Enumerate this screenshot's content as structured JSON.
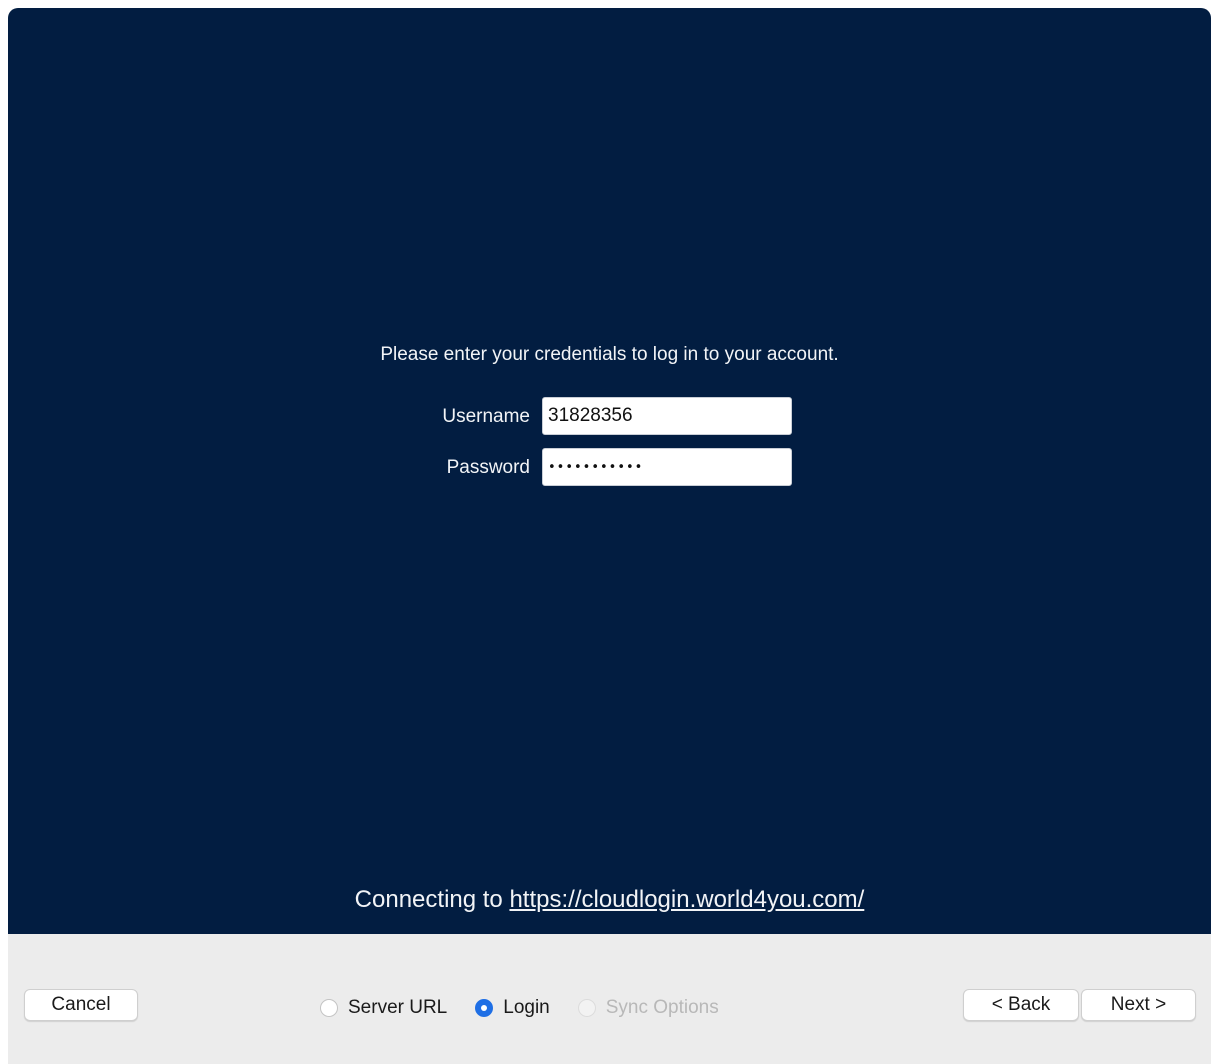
{
  "content": {
    "instruction": "Please enter your credentials to log in to your account.",
    "username_label": "Username",
    "username_value": "31828356",
    "password_label": "Password",
    "password_value": "•••••••••••",
    "connecting_prefix": "Connecting to",
    "server_url": "https://cloudlogin.world4you.com/"
  },
  "footer": {
    "cancel_label": "Cancel",
    "back_label": "< Back",
    "next_label": "Next >",
    "steps": [
      {
        "label": "Server URL",
        "state": "unselected"
      },
      {
        "label": "Login",
        "state": "selected"
      },
      {
        "label": "Sync Options",
        "state": "disabled"
      }
    ]
  },
  "colors": {
    "content_background": "#021d41",
    "footer_background": "#ececec",
    "accent": "#1f6fe5"
  }
}
